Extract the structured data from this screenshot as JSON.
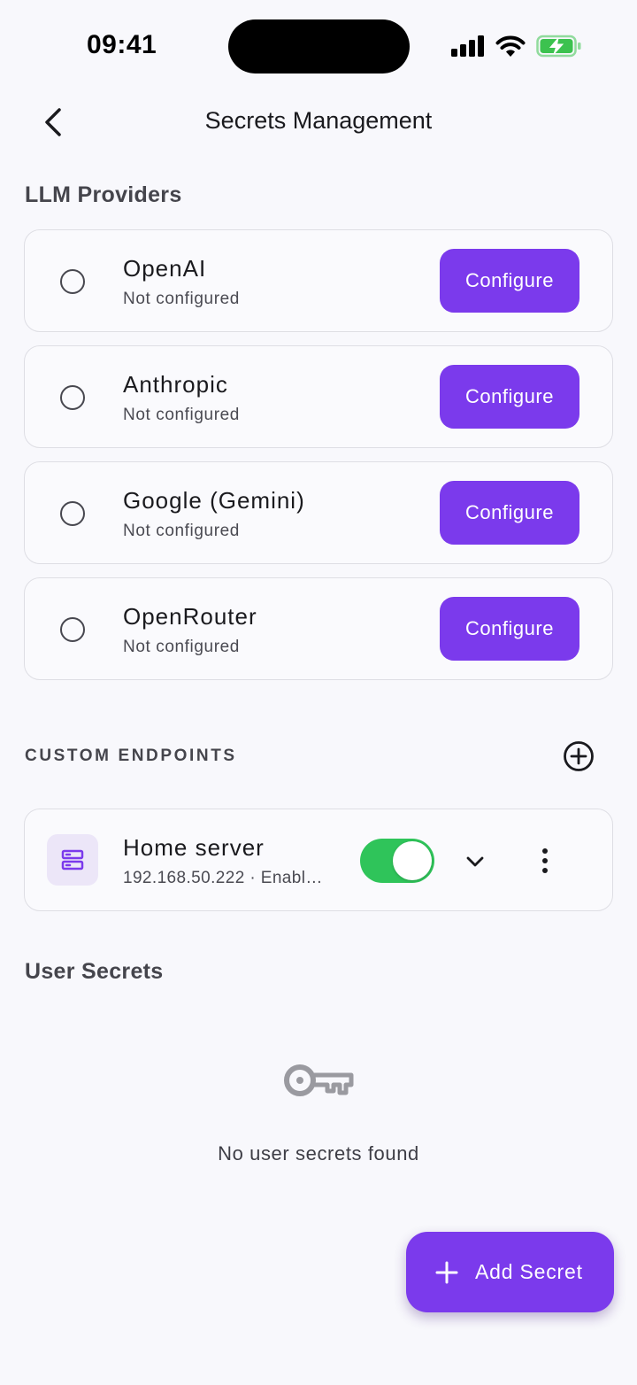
{
  "status_bar": {
    "time": "09:41"
  },
  "header": {
    "title": "Secrets Management"
  },
  "llm_section": {
    "title": "LLM Providers"
  },
  "providers": [
    {
      "name": "OpenAI",
      "status": "Not configured",
      "button": "Configure"
    },
    {
      "name": "Anthropic",
      "status": "Not configured",
      "button": "Configure"
    },
    {
      "name": "Google (Gemini)",
      "status": "Not configured",
      "button": "Configure"
    },
    {
      "name": "OpenRouter",
      "status": "Not configured",
      "button": "Configure"
    }
  ],
  "custom_endpoints": {
    "title": "CUSTOM ENDPOINTS",
    "items": [
      {
        "name": "Home server",
        "subtitle": "192.168.50.222 · Enabl…",
        "enabled": true
      }
    ]
  },
  "user_secrets": {
    "title": "User Secrets",
    "empty_text": "No user secrets found"
  },
  "fab": {
    "label": "Add Secret"
  },
  "colors": {
    "accent": "#7b3aec",
    "toggle_on": "#2fc45a",
    "battery_charge": "#3cc24f",
    "background": "#f8f8fc"
  }
}
